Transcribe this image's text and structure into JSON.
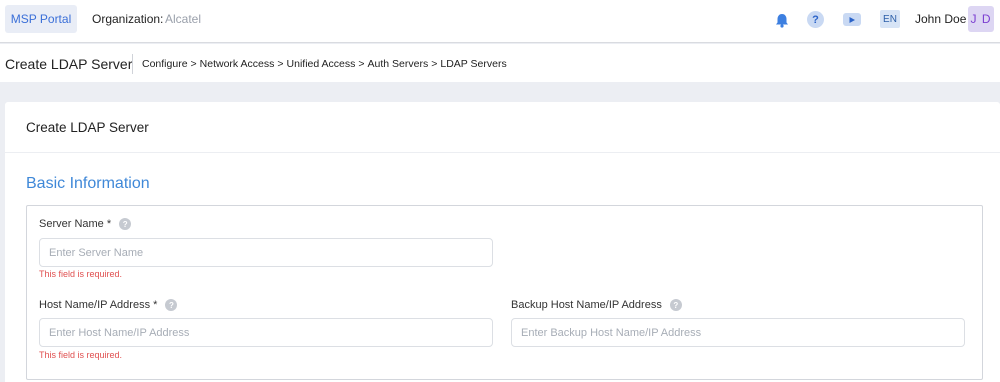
{
  "header": {
    "portal_button": "MSP Portal",
    "org_label": "Organization:",
    "org_value": "Alcatel",
    "lang": "EN",
    "user_name": "John Doe",
    "avatar_initials": "J D",
    "icons": [
      "bell-icon",
      "help-icon",
      "video-icon"
    ]
  },
  "titlebar": {
    "title": "Create LDAP Server",
    "breadcrumb": [
      "Configure",
      "Network Access",
      "Unified Access",
      "Auth Servers",
      "LDAP Servers"
    ],
    "separator": ">"
  },
  "card": {
    "title": "Create LDAP Server",
    "section_title": "Basic Information"
  },
  "form": {
    "server_name": {
      "label": "Server Name *",
      "placeholder": "Enter Server Name",
      "value": "",
      "error": "This field is required."
    },
    "host_name": {
      "label": "Host Name/IP Address *",
      "placeholder": "Enter Host Name/IP Address",
      "value": "",
      "error": "This field is required."
    },
    "backup_host": {
      "label": "Backup Host Name/IP Address",
      "placeholder": "Enter Backup Host Name/IP Address",
      "value": ""
    }
  },
  "colors": {
    "accent": "#3f88d8",
    "error": "#e05050",
    "avatar_bg": "#ddd6f3",
    "avatar_fg": "#7c3fd1"
  }
}
